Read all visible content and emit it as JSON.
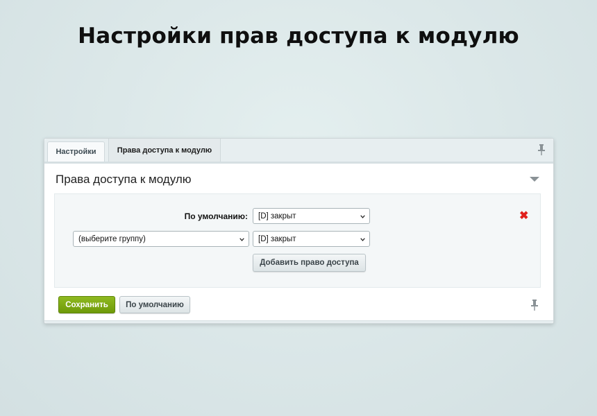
{
  "page": {
    "title": "Настройки прав доступа к модулю"
  },
  "tabs": [
    {
      "label": "Настройки",
      "active": false
    },
    {
      "label": "Права доступа к модулю",
      "active": true
    }
  ],
  "section": {
    "title": "Права доступа к модулю"
  },
  "permissions": {
    "default_label": "По умолчанию:",
    "default_value": "[D] закрыт",
    "group_select_value": "(выберите группу)",
    "group_access_value": "[D] закрыт",
    "add_button_label": "Добавить право доступа"
  },
  "footer": {
    "save_label": "Сохранить",
    "default_label": "По умолчанию"
  },
  "colors": {
    "save_button": "#7aa612",
    "delete_icon": "#e0201d"
  },
  "icons": [
    "pin-icon",
    "collapse-arrow-icon",
    "delete-icon",
    "chevron-down-icon"
  ]
}
